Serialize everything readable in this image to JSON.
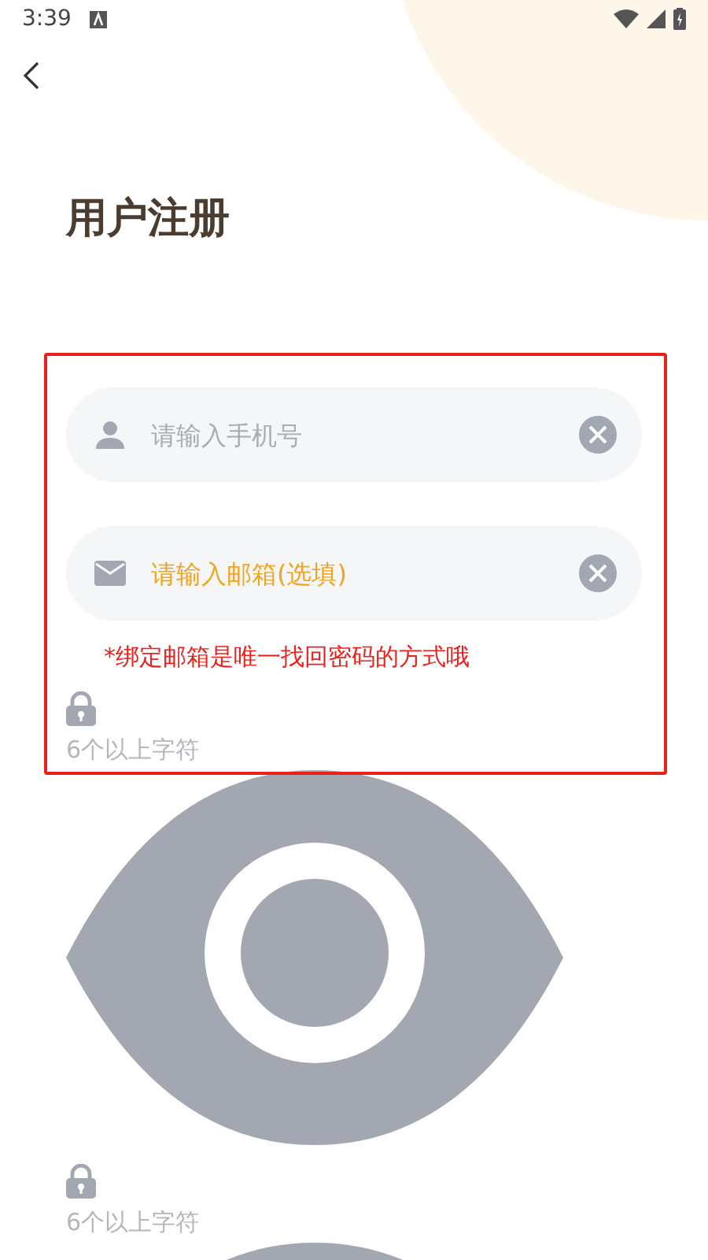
{
  "status_bar": {
    "time": "3:39"
  },
  "title": "用户注册",
  "fields": [
    {
      "kind": "phone",
      "placeholder": "请输入手机号",
      "focused": false
    },
    {
      "kind": "email",
      "placeholder": "请输入邮箱(选填)",
      "focused": true
    }
  ],
  "email_hint": "*绑定邮箱是唯一找回密码的方式哦",
  "password_fields": [
    {
      "placeholder": "6个以上字符"
    },
    {
      "placeholder": "6个以上字符"
    }
  ]
}
